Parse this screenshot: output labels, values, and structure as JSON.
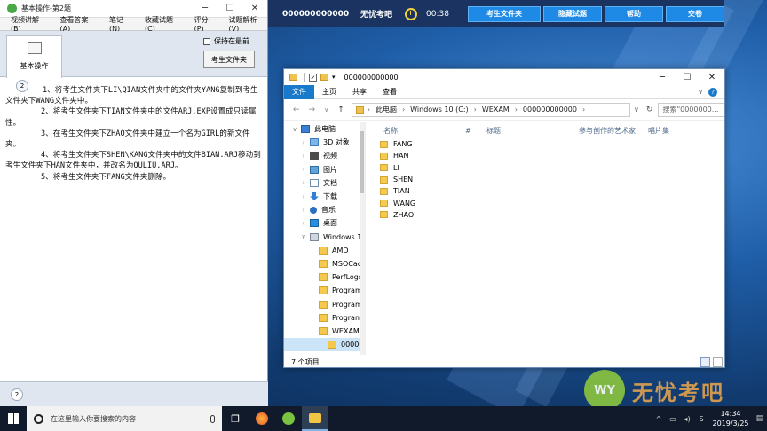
{
  "exam_bar": {
    "candidate_number": "000000000000",
    "mode": "无忧考吧",
    "timer": "00:38",
    "buttons": [
      "考生文件夹",
      "隐藏试题",
      "帮助",
      "交卷"
    ]
  },
  "question_window": {
    "title": "基本操作-第2题",
    "menu": [
      "视频讲解(B)",
      "查看答案(A)",
      "笔记(N)",
      "收藏试题(C)",
      "评分(P)",
      "试题解析(V)"
    ],
    "tab_label": "基本操作",
    "keep_on_top_label": "保持在最前",
    "folder_button": "考生文件夹",
    "question_number": "2",
    "paragraphs": [
      "1、将考生文件夹下LI\\QIAN文件夹中的文件夹YANG复制到考生文件夹下WANG文件夹中。",
      "2、将考生文件夹下TIAN文件夹中的文件ARJ.EXP设置成只读属性。",
      "3、在考生文件夹下ZHAO文件夹中建立一个名为GIRL的新文件夹。",
      "4、将考生文件夹下SHEN\\KANG文件夹中的文件BIAN.ARJ移动到考生文件夹下HAN文件夹中，并改名为QULIU.ARJ。",
      "5、将考生文件夹下FANG文件夹删除。"
    ],
    "footer_number": "2"
  },
  "explorer": {
    "title": "000000000000",
    "ribbon_tabs": [
      "文件",
      "主页",
      "共享",
      "查看"
    ],
    "breadcrumb": [
      "此电脑",
      "Windows 10 (C:)",
      "WEXAM",
      "000000000000"
    ],
    "search_placeholder": "搜索\"0000000...",
    "nav_items": [
      {
        "label": "此电脑",
        "icon": "pc",
        "indent": 0
      },
      {
        "label": "3D 对象",
        "icon": "cube",
        "indent": 1
      },
      {
        "label": "视频",
        "icon": "video",
        "indent": 1
      },
      {
        "label": "图片",
        "icon": "pic",
        "indent": 1
      },
      {
        "label": "文档",
        "icon": "doc",
        "indent": 1
      },
      {
        "label": "下载",
        "icon": "down",
        "indent": 1
      },
      {
        "label": "音乐",
        "icon": "music",
        "indent": 1
      },
      {
        "label": "桌面",
        "icon": "desk",
        "indent": 1
      },
      {
        "label": "Windows 10 (C",
        "icon": "drive",
        "indent": 1
      },
      {
        "label": "AMD",
        "icon": "fold",
        "indent": 2
      },
      {
        "label": "MSOCache",
        "icon": "fold",
        "indent": 2
      },
      {
        "label": "PerfLogs",
        "icon": "fold",
        "indent": 2
      },
      {
        "label": "Program Files",
        "icon": "fold",
        "indent": 2
      },
      {
        "label": "Program Files",
        "icon": "fold",
        "indent": 2
      },
      {
        "label": "ProgramData",
        "icon": "fold",
        "indent": 2
      },
      {
        "label": "WEXAM",
        "icon": "fold",
        "indent": 2
      },
      {
        "label": "0000000000",
        "icon": "fold",
        "indent": 3
      }
    ],
    "columns": [
      "名称",
      "#",
      "标题",
      "参与创作的艺术家",
      "唱片集"
    ],
    "files": [
      "FANG",
      "HAN",
      "LI",
      "SHEN",
      "TIAN",
      "WANG",
      "ZHAO"
    ],
    "status": "7 个项目"
  },
  "watermark": {
    "logo": "WY",
    "text": "无忧考吧"
  },
  "taskbar": {
    "search_placeholder": "在这里输入你要搜索的内容",
    "time": "14:34",
    "date": "2019/3/25"
  }
}
